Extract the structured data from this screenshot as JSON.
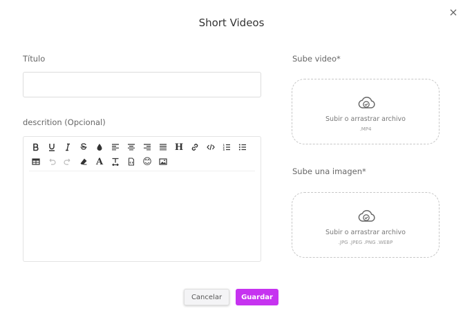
{
  "modal": {
    "title": "Short Videos"
  },
  "form": {
    "titulo_label": "Título",
    "titulo_value": "",
    "descripcion_label": "descrition (Opcional)"
  },
  "editor": {
    "toolbar": [
      "bold-icon",
      "underline-icon",
      "italic-icon",
      "strikethrough-icon",
      "color-drop-icon",
      "align-left-icon",
      "align-center-icon",
      "align-right-icon",
      "align-justify-icon",
      "heading-icon",
      "link-icon",
      "code-icon",
      "ordered-list-icon",
      "unordered-list-icon",
      "table-icon",
      "undo-icon",
      "redo-icon",
      "eraser-icon",
      "font-icon",
      "text-size-icon",
      "document-code-icon",
      "emoji-icon",
      "image-icon"
    ],
    "heading_glyph": "H",
    "font_glyph": "A",
    "emoji_glyph": "😊",
    "content": ""
  },
  "video_upload": {
    "label": "Sube video*",
    "main_text": "Subir o arrastrar archivo",
    "formats": ".MP4"
  },
  "image_upload": {
    "label": "Sube una imagen*",
    "main_text": "Subir o arrastrar archivo",
    "formats": ".JPG .JPEG .PNG .WEBP"
  },
  "actions": {
    "cancel_label": "Cancelar",
    "save_label": "Guardar"
  },
  "colors": {
    "accent": "#c633f0",
    "cancel_bg": "#f4f4f6"
  }
}
